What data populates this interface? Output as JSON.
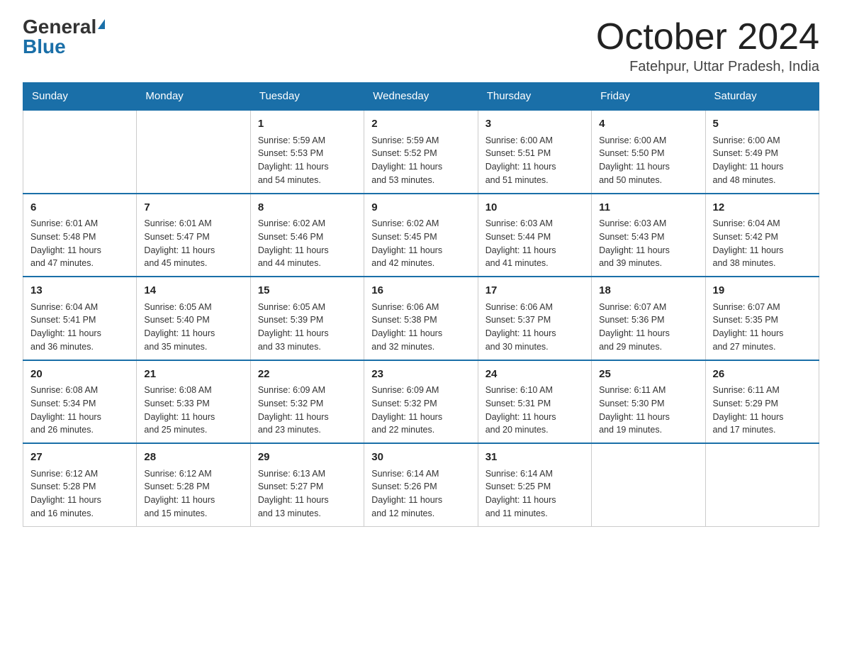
{
  "header": {
    "logo_general": "General",
    "logo_blue": "Blue",
    "month_title": "October 2024",
    "location": "Fatehpur, Uttar Pradesh, India"
  },
  "days_of_week": [
    "Sunday",
    "Monday",
    "Tuesday",
    "Wednesday",
    "Thursday",
    "Friday",
    "Saturday"
  ],
  "weeks": [
    [
      {
        "day": "",
        "info": ""
      },
      {
        "day": "",
        "info": ""
      },
      {
        "day": "1",
        "info": "Sunrise: 5:59 AM\nSunset: 5:53 PM\nDaylight: 11 hours\nand 54 minutes."
      },
      {
        "day": "2",
        "info": "Sunrise: 5:59 AM\nSunset: 5:52 PM\nDaylight: 11 hours\nand 53 minutes."
      },
      {
        "day": "3",
        "info": "Sunrise: 6:00 AM\nSunset: 5:51 PM\nDaylight: 11 hours\nand 51 minutes."
      },
      {
        "day": "4",
        "info": "Sunrise: 6:00 AM\nSunset: 5:50 PM\nDaylight: 11 hours\nand 50 minutes."
      },
      {
        "day": "5",
        "info": "Sunrise: 6:00 AM\nSunset: 5:49 PM\nDaylight: 11 hours\nand 48 minutes."
      }
    ],
    [
      {
        "day": "6",
        "info": "Sunrise: 6:01 AM\nSunset: 5:48 PM\nDaylight: 11 hours\nand 47 minutes."
      },
      {
        "day": "7",
        "info": "Sunrise: 6:01 AM\nSunset: 5:47 PM\nDaylight: 11 hours\nand 45 minutes."
      },
      {
        "day": "8",
        "info": "Sunrise: 6:02 AM\nSunset: 5:46 PM\nDaylight: 11 hours\nand 44 minutes."
      },
      {
        "day": "9",
        "info": "Sunrise: 6:02 AM\nSunset: 5:45 PM\nDaylight: 11 hours\nand 42 minutes."
      },
      {
        "day": "10",
        "info": "Sunrise: 6:03 AM\nSunset: 5:44 PM\nDaylight: 11 hours\nand 41 minutes."
      },
      {
        "day": "11",
        "info": "Sunrise: 6:03 AM\nSunset: 5:43 PM\nDaylight: 11 hours\nand 39 minutes."
      },
      {
        "day": "12",
        "info": "Sunrise: 6:04 AM\nSunset: 5:42 PM\nDaylight: 11 hours\nand 38 minutes."
      }
    ],
    [
      {
        "day": "13",
        "info": "Sunrise: 6:04 AM\nSunset: 5:41 PM\nDaylight: 11 hours\nand 36 minutes."
      },
      {
        "day": "14",
        "info": "Sunrise: 6:05 AM\nSunset: 5:40 PM\nDaylight: 11 hours\nand 35 minutes."
      },
      {
        "day": "15",
        "info": "Sunrise: 6:05 AM\nSunset: 5:39 PM\nDaylight: 11 hours\nand 33 minutes."
      },
      {
        "day": "16",
        "info": "Sunrise: 6:06 AM\nSunset: 5:38 PM\nDaylight: 11 hours\nand 32 minutes."
      },
      {
        "day": "17",
        "info": "Sunrise: 6:06 AM\nSunset: 5:37 PM\nDaylight: 11 hours\nand 30 minutes."
      },
      {
        "day": "18",
        "info": "Sunrise: 6:07 AM\nSunset: 5:36 PM\nDaylight: 11 hours\nand 29 minutes."
      },
      {
        "day": "19",
        "info": "Sunrise: 6:07 AM\nSunset: 5:35 PM\nDaylight: 11 hours\nand 27 minutes."
      }
    ],
    [
      {
        "day": "20",
        "info": "Sunrise: 6:08 AM\nSunset: 5:34 PM\nDaylight: 11 hours\nand 26 minutes."
      },
      {
        "day": "21",
        "info": "Sunrise: 6:08 AM\nSunset: 5:33 PM\nDaylight: 11 hours\nand 25 minutes."
      },
      {
        "day": "22",
        "info": "Sunrise: 6:09 AM\nSunset: 5:32 PM\nDaylight: 11 hours\nand 23 minutes."
      },
      {
        "day": "23",
        "info": "Sunrise: 6:09 AM\nSunset: 5:32 PM\nDaylight: 11 hours\nand 22 minutes."
      },
      {
        "day": "24",
        "info": "Sunrise: 6:10 AM\nSunset: 5:31 PM\nDaylight: 11 hours\nand 20 minutes."
      },
      {
        "day": "25",
        "info": "Sunrise: 6:11 AM\nSunset: 5:30 PM\nDaylight: 11 hours\nand 19 minutes."
      },
      {
        "day": "26",
        "info": "Sunrise: 6:11 AM\nSunset: 5:29 PM\nDaylight: 11 hours\nand 17 minutes."
      }
    ],
    [
      {
        "day": "27",
        "info": "Sunrise: 6:12 AM\nSunset: 5:28 PM\nDaylight: 11 hours\nand 16 minutes."
      },
      {
        "day": "28",
        "info": "Sunrise: 6:12 AM\nSunset: 5:28 PM\nDaylight: 11 hours\nand 15 minutes."
      },
      {
        "day": "29",
        "info": "Sunrise: 6:13 AM\nSunset: 5:27 PM\nDaylight: 11 hours\nand 13 minutes."
      },
      {
        "day": "30",
        "info": "Sunrise: 6:14 AM\nSunset: 5:26 PM\nDaylight: 11 hours\nand 12 minutes."
      },
      {
        "day": "31",
        "info": "Sunrise: 6:14 AM\nSunset: 5:25 PM\nDaylight: 11 hours\nand 11 minutes."
      },
      {
        "day": "",
        "info": ""
      },
      {
        "day": "",
        "info": ""
      }
    ]
  ]
}
